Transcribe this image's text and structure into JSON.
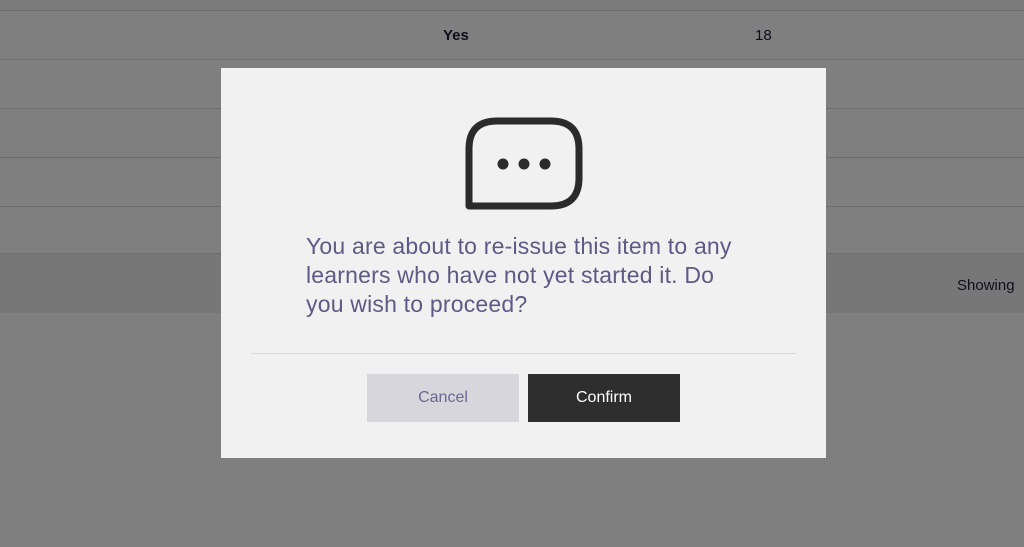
{
  "background": {
    "row1": {
      "yes_label": "Yes",
      "count": "18"
    },
    "footer_showing": "Showing"
  },
  "dialog": {
    "icon": "speech-bubble-ellipsis-icon",
    "message": "You are about to re-issue this item to any learners who have not yet started it. Do you wish to proceed?",
    "cancel_label": "Cancel",
    "confirm_label": "Confirm"
  },
  "colors": {
    "message_text": "#5d5a86",
    "confirm_bg": "#2e2e2e",
    "cancel_bg": "#d6d6dc",
    "modal_bg": "#f1f1f1"
  }
}
